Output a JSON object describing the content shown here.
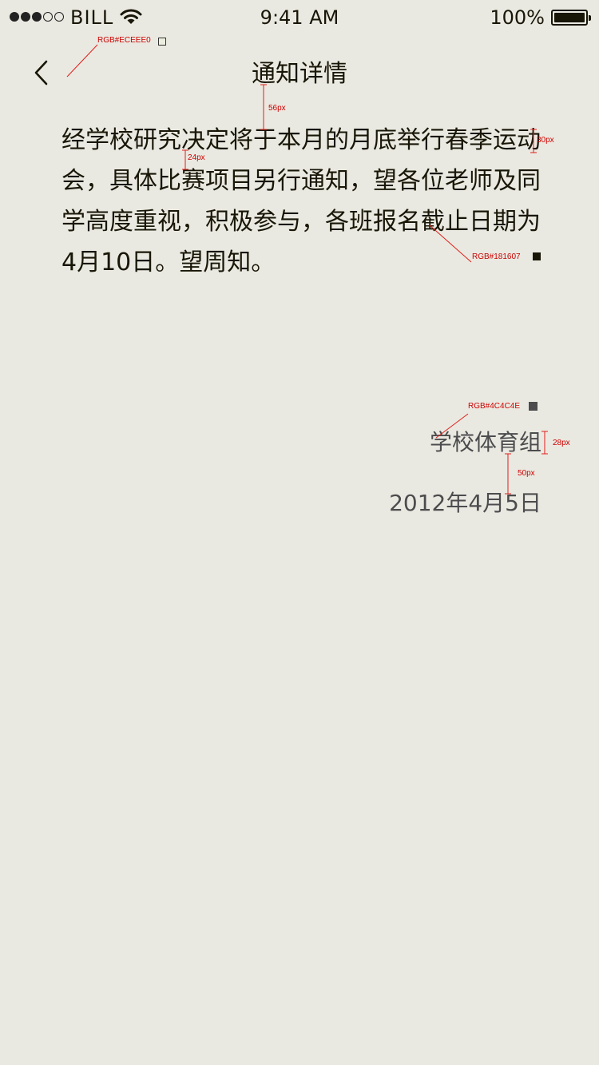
{
  "status_bar": {
    "carrier": "BILL",
    "time": "9:41 AM",
    "battery": "100%",
    "signal_bars_filled": 3,
    "signal_bars_total": 5
  },
  "nav": {
    "title": "通知详情",
    "back_icon": "chevron-left-icon"
  },
  "notice": {
    "body": "经学校研究决定将于本月的月底举行春季运动会，具体比赛项目另行通知，望各位老师及同学高度重视，积极参与，各班报名截止日期为4月10日。望周知。",
    "signature": "学校体育组",
    "date": "2012年4月5日"
  },
  "annotations": {
    "bg_color_label": "RGB#ECEEE0",
    "title_gap": "56px",
    "body_size": "30px",
    "line_gap": "24px",
    "body_color_label": "RGB#181607",
    "signature_color_label": "RGB#4C4C4E",
    "signature_size": "28px",
    "date_gap": "50px"
  },
  "colors": {
    "background": "#ECEEE0",
    "body_text": "#181607",
    "secondary_text": "#4C4C4E",
    "annotation": "#CC0000"
  }
}
